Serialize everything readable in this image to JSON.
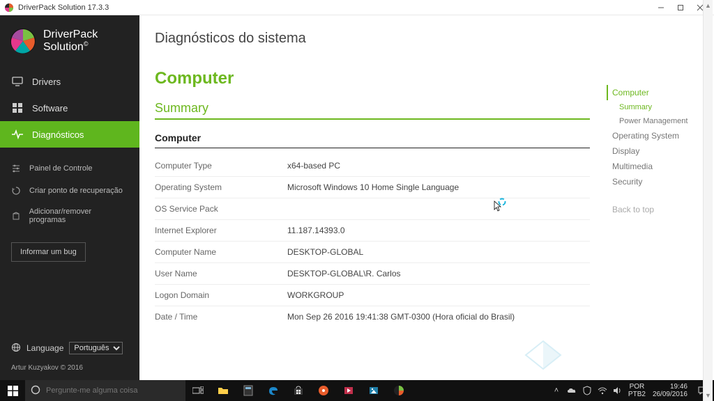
{
  "window": {
    "title": "DriverPack Solution 17.3.3"
  },
  "brand": {
    "line1": "DriverPack",
    "line2": "Solution"
  },
  "nav": {
    "drivers": "Drivers",
    "software": "Software",
    "diagnostics": "Diagnósticos"
  },
  "tools": {
    "control_panel": "Painel de Controle",
    "restore_point": "Criar ponto de recuperação",
    "add_remove": "Adicionar/remover programas"
  },
  "bug_button": "Informar um bug",
  "language": {
    "label": "Language",
    "selected": "Português"
  },
  "copyright": "Artur Kuzyakov © 2016",
  "page": {
    "title": "Diagnósticos do sistema",
    "h_computer": "Computer",
    "h_summary": "Summary",
    "h_sub": "Computer"
  },
  "rows": {
    "computer_type": {
      "k": "Computer Type",
      "v": "x64-based PC"
    },
    "os": {
      "k": "Operating System",
      "v": "Microsoft Windows 10 Home Single Language"
    },
    "sp": {
      "k": "OS Service Pack",
      "v": ""
    },
    "ie": {
      "k": "Internet Explorer",
      "v": "11.187.14393.0"
    },
    "cname": {
      "k": "Computer Name",
      "v": "DESKTOP-GLOBAL"
    },
    "uname": {
      "k": "User Name",
      "v": "DESKTOP-GLOBAL\\R. Carlos"
    },
    "domain": {
      "k": "Logon Domain",
      "v": "WORKGROUP"
    },
    "datetime": {
      "k": "Date / Time",
      "v": "Mon Sep 26 2016 19:41:38 GMT-0300 (Hora oficial do Brasil)"
    }
  },
  "toc": {
    "computer": "Computer",
    "summary": "Summary",
    "power": "Power Management",
    "os": "Operating System",
    "display": "Display",
    "multimedia": "Multimedia",
    "security": "Security",
    "back": "Back to top"
  },
  "taskbar": {
    "search_placeholder": "Pergunte-me alguma coisa",
    "lang1": "POR",
    "lang2": "PTB2",
    "time": "19:46",
    "date": "26/09/2016"
  },
  "colors": {
    "accent": "#6db81f",
    "sidebar": "#222222"
  }
}
